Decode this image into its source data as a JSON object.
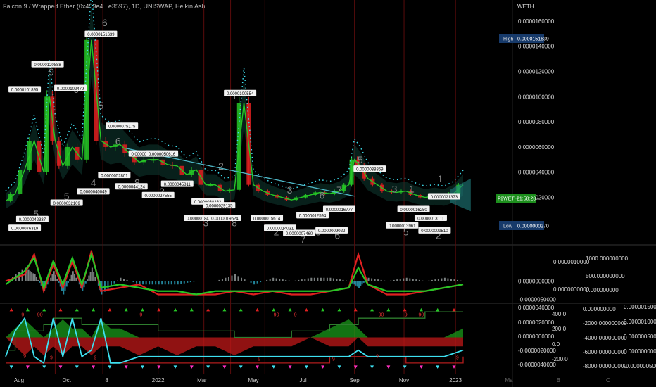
{
  "header": {
    "title": "Falcon 9 / Wrapped Ether (0x459e4...e3597), 1D, UNISWAP, Heikin Ashi"
  },
  "price_unit": "WETH",
  "colors": {
    "up": "#26c726",
    "down": "#e02020",
    "cyan": "#3ee0f0",
    "magenta": "#ff30c0",
    "olive": "#2e7d2e",
    "teal": "#1f7f7f"
  },
  "chart_data": [
    {
      "type": "line",
      "title": "",
      "y_axis_ticks": [
        "0.0000160000",
        "0.0000140000",
        "0.0000120000",
        "0.0000100000",
        "0.0000080000",
        "0.0000060000",
        "0.0000040000",
        "0.0000020000"
      ],
      "y_ticks_values": [
        16.0,
        14.0,
        12.0,
        10.0,
        8.0,
        6.0,
        4.0,
        2.0
      ],
      "ylim": [
        -1.6,
        17.0
      ],
      "value_scale": "1e-6 WETH",
      "x_axis_ticks": [
        "Aug",
        "Oct",
        "8",
        "2022",
        "Mar",
        "May",
        "Jul",
        "Sep",
        "Nov",
        "2023",
        "Ma",
        "B",
        "C",
        "D"
      ],
      "x_tick_index": [
        0.7,
        3.2,
        5.3,
        8.0,
        10.3,
        13.0,
        15.6,
        18.3,
        20.9,
        23.6,
        26.4,
        29.0,
        31.6,
        34.3
      ],
      "series": [
        {
          "role": "price",
          "x": [
            0,
            0.5,
            1,
            1.5,
            2,
            2.3,
            2.6,
            3,
            3.5,
            4,
            4.5,
            5,
            5.5,
            6,
            6.5,
            7,
            7.5,
            8,
            8.5,
            9,
            9.5,
            10,
            10.5,
            11,
            11.5,
            12,
            12.5,
            13,
            13.5,
            14,
            14.5,
            15,
            15.5,
            16,
            16.5,
            17,
            17.5,
            18,
            18.3,
            18.6,
            19,
            19.5,
            20,
            20.5,
            21,
            21.5,
            22,
            22.5,
            23,
            23.5,
            24
          ],
          "values": [
            1.7,
            2.3,
            4.2,
            6.5,
            4.0,
            10.0,
            6.5,
            4.5,
            6.0,
            5.0,
            14.5,
            6.5,
            6.0,
            6.2,
            5.5,
            4.8,
            5.0,
            5.0,
            4.6,
            4.5,
            3.8,
            4.2,
            3.0,
            3.0,
            2.5,
            2.6,
            9.5,
            3.0,
            2.5,
            2.2,
            2.0,
            1.8,
            2.0,
            2.2,
            2.4,
            2.3,
            2.5,
            3.0,
            5.0,
            4.5,
            3.5,
            3.0,
            2.5,
            2.4,
            2.5,
            2.2,
            2.0,
            2.1,
            2.0,
            2.3,
            3.0
          ]
        }
      ],
      "markers": {
        "high_label": "High",
        "high_value": "0.0000151639",
        "low_label": "Low",
        "low_value": "0.0000000270",
        "last_symbol": "F9WETH",
        "last_time": "21:58:28"
      },
      "counts": [
        {
          "x": 1.6,
          "y": 0.4,
          "text": "5"
        },
        {
          "x": 2.4,
          "y": 11.7,
          "text": "9"
        },
        {
          "x": 3.2,
          "y": 1.8,
          "text": "5"
        },
        {
          "x": 3.7,
          "y": 10.3,
          "text": "6"
        },
        {
          "x": 4.6,
          "y": 2.9,
          "text": "4"
        },
        {
          "x": 5.2,
          "y": 15.6,
          "text": "6"
        },
        {
          "x": 5.0,
          "y": 9.0,
          "text": "5"
        },
        {
          "x": 5.9,
          "y": 6.2,
          "text": "6"
        },
        {
          "x": 6.9,
          "y": 2.9,
          "text": "8"
        },
        {
          "x": 8.2,
          "y": 2.2,
          "text": "2"
        },
        {
          "x": 10.5,
          "y": -0.3,
          "text": "3"
        },
        {
          "x": 11.3,
          "y": 4.2,
          "text": "2"
        },
        {
          "x": 12.0,
          "y": -0.3,
          "text": "8"
        },
        {
          "x": 12.0,
          "y": 9.8,
          "text": "1"
        },
        {
          "x": 14.2,
          "y": -1.0,
          "text": "2"
        },
        {
          "x": 14.9,
          "y": 2.3,
          "text": "3"
        },
        {
          "x": 15.6,
          "y": -1.6,
          "text": "7"
        },
        {
          "x": 16.4,
          "y": -1.0,
          "text": "3"
        },
        {
          "x": 16.6,
          "y": 1.9,
          "text": "6"
        },
        {
          "x": 17.4,
          "y": -1.3,
          "text": "6"
        },
        {
          "x": 17.5,
          "y": 2.3,
          "text": "7"
        },
        {
          "x": 18.6,
          "y": 4.7,
          "text": "5"
        },
        {
          "x": 20.4,
          "y": 2.4,
          "text": "3"
        },
        {
          "x": 21.0,
          "y": -1.0,
          "text": "5"
        },
        {
          "x": 21.3,
          "y": 2.4,
          "text": "1"
        },
        {
          "x": 22.7,
          "y": -1.3,
          "text": "2"
        },
        {
          "x": 22.8,
          "y": 3.2,
          "text": "1"
        }
      ],
      "value_labels": [
        {
          "x": 1.0,
          "y": -0.5,
          "text": "0.0000076319"
        },
        {
          "x": 1.4,
          "y": 0.2,
          "text": "0.0000042337"
        },
        {
          "x": 1.0,
          "y": 10.5,
          "text": "0.0000101895"
        },
        {
          "x": 2.2,
          "y": 12.5,
          "text": "0.0000120888"
        },
        {
          "x": 3.2,
          "y": 1.5,
          "text": "0.0000032109"
        },
        {
          "x": 3.4,
          "y": 10.6,
          "text": "0.0000102479"
        },
        {
          "x": 4.6,
          "y": 2.4,
          "text": "0.0000040049"
        },
        {
          "x": 5.0,
          "y": 14.9,
          "text": "0.0000151639"
        },
        {
          "x": 5.7,
          "y": 3.7,
          "text": "0.0000052801"
        },
        {
          "x": 6.1,
          "y": 7.6,
          "text": "0.0000075175"
        },
        {
          "x": 6.6,
          "y": 2.8,
          "text": "0.0000044124"
        },
        {
          "x": 7.3,
          "y": 5.4,
          "text": "0.0000050036"
        },
        {
          "x": 8.0,
          "y": 2.1,
          "text": "0.0000027555"
        },
        {
          "x": 8.2,
          "y": 5.4,
          "text": "0.0000050616"
        },
        {
          "x": 9.0,
          "y": 3.0,
          "text": "0.0000045811"
        },
        {
          "x": 10.2,
          "y": 0.3,
          "text": "0.0000018452"
        },
        {
          "x": 10.6,
          "y": 1.6,
          "text": "0.0000038262"
        },
        {
          "x": 11.2,
          "y": 1.3,
          "text": "0.0000029135"
        },
        {
          "x": 11.5,
          "y": 0.3,
          "text": "0.0000019524"
        },
        {
          "x": 12.3,
          "y": 10.2,
          "text": "0.0000100554"
        },
        {
          "x": 13.7,
          "y": 0.3,
          "text": "0.0000015614"
        },
        {
          "x": 14.4,
          "y": -0.5,
          "text": "0.0000014031"
        },
        {
          "x": 15.4,
          "y": -0.9,
          "text": "0.0000007460"
        },
        {
          "x": 16.1,
          "y": 0.5,
          "text": "0.0000012594"
        },
        {
          "x": 17.1,
          "y": -0.7,
          "text": "0.0000009022"
        },
        {
          "x": 17.5,
          "y": 1.0,
          "text": "0.0000016777"
        },
        {
          "x": 19.1,
          "y": 4.2,
          "text": "0.0000038869"
        },
        {
          "x": 20.8,
          "y": -0.3,
          "text": "0.0000013961"
        },
        {
          "x": 21.4,
          "y": 1.0,
          "text": "0.0000016250"
        },
        {
          "x": 22.3,
          "y": 0.3,
          "text": "0.0000013111"
        },
        {
          "x": 22.5,
          "y": -0.7,
          "text": "0.0000009510"
        },
        {
          "x": 23.0,
          "y": 2.0,
          "text": "0.0000021373"
        }
      ]
    },
    {
      "type": "area",
      "title": "",
      "y_axis_ticks": [
        "0.0000000000",
        "-0.0000050000"
      ],
      "ticks_mid": [
        "0.0000010000",
        "0.0000000000"
      ],
      "ticks_right": [
        "1000.000000000",
        "500.000000000",
        "0.000000000"
      ],
      "ylim": [
        -6,
        10
      ],
      "x": [
        0,
        1,
        1.5,
        2,
        2.5,
        3,
        3.5,
        4,
        4.5,
        5,
        6,
        7,
        8,
        9,
        10,
        11,
        12,
        13,
        14,
        15,
        16,
        17,
        18,
        18.5,
        19,
        20,
        21,
        22,
        23,
        24
      ],
      "series": [
        {
          "role": "oscillator_red",
          "values": [
            0,
            2,
            8,
            -3,
            5,
            -2,
            6,
            -2,
            9,
            -3,
            -2,
            -1,
            -4,
            -4,
            -4,
            -4,
            -3,
            -4,
            -3,
            -4,
            -4,
            -3,
            -2,
            8,
            -1,
            -4,
            -4,
            -3,
            -2,
            -1
          ]
        },
        {
          "role": "oscillator_green",
          "values": [
            -1,
            3,
            7,
            -2,
            6,
            -1,
            7,
            -1,
            8,
            -2,
            -1,
            -2,
            -3,
            -3,
            -4,
            -3,
            -3,
            -3,
            -3,
            -3,
            -3,
            -3,
            -2,
            4,
            -1,
            -3,
            -3,
            -3,
            -2,
            -1
          ]
        },
        {
          "role": "histogram",
          "values": [
            0,
            4,
            2,
            -3,
            3,
            -4,
            3,
            -3,
            4,
            -4,
            1,
            -1,
            -1,
            -1,
            0,
            0,
            2,
            -1,
            1,
            0,
            1,
            1,
            0,
            -2,
            1,
            0,
            1,
            0,
            1,
            0
          ]
        }
      ]
    },
    {
      "type": "line",
      "title": "",
      "y_axis_ticks": [
        "0.0000040000",
        "0.0000020000",
        "0.0000000000",
        "-0.0000020000",
        "-0.0000040000"
      ],
      "ticks_mid": [
        "400.0",
        "200.0",
        "0.0",
        "-200.0"
      ],
      "ticks_right1": [
        "0.000000000",
        "-2000.000000000",
        "-4000.000000000",
        "-6000.000000000",
        "-8000.000000000"
      ],
      "ticks_right2": [
        "0.0000015000",
        "0.0000010000",
        "0.0000005000",
        "0.0000000000",
        "-0.0000005000"
      ],
      "ylim": [
        -5,
        5
      ],
      "x": [
        0,
        0.5,
        1,
        1.5,
        2,
        2.5,
        3,
        3.5,
        4,
        4.5,
        5,
        5.5,
        6,
        7,
        8,
        9,
        10,
        11,
        12,
        13,
        14,
        15,
        16,
        17,
        18,
        18.5,
        19,
        20,
        21,
        22,
        23,
        24
      ],
      "series": [
        {
          "role": "cyan_line",
          "values": [
            -3,
            1,
            3,
            -3,
            -4,
            3,
            -3,
            3,
            -3,
            -2,
            3,
            -4,
            -4,
            -3,
            -3,
            -3,
            -3,
            -3,
            -3,
            -3,
            -3,
            -3,
            -3,
            -3,
            -3,
            -2,
            -3,
            -3,
            -3,
            -3,
            -3,
            -2
          ]
        },
        {
          "role": "green_step",
          "values": [
            -2,
            1,
            1,
            1,
            2,
            3,
            3,
            3,
            2,
            2,
            2,
            2,
            2,
            2,
            1,
            1,
            1,
            1,
            0,
            0,
            0,
            1,
            1,
            2,
            2,
            3,
            3,
            3,
            3,
            4,
            4,
            4
          ]
        },
        {
          "role": "red_step",
          "values": [
            -4,
            -4,
            -4,
            -4,
            -4,
            -4,
            -4,
            -4,
            -4,
            -4,
            -4,
            -4,
            -4,
            -4,
            -4,
            -4,
            -4,
            -4,
            -4,
            -4,
            -4,
            -4,
            -4,
            -3,
            -3,
            -3,
            -3,
            -3,
            -4,
            -4,
            -4,
            -3
          ]
        },
        {
          "role": "red_area",
          "values": [
            0,
            -1,
            -2,
            -1,
            -2,
            -1,
            -2,
            -1,
            -1,
            -2,
            -1,
            -1,
            -1,
            -2,
            -1,
            -2,
            -1,
            -1,
            -2,
            -1,
            -1,
            -1,
            0,
            -1,
            -1,
            0,
            -1,
            -1,
            -1,
            -1,
            -1,
            -1
          ]
        },
        {
          "role": "green_area",
          "values": [
            0,
            1,
            2,
            1,
            0,
            1,
            2,
            1,
            1,
            0,
            2,
            1,
            1,
            0,
            0,
            0,
            0,
            0,
            0,
            0,
            0,
            0,
            0,
            1,
            2,
            1,
            0,
            0,
            0,
            0,
            0,
            1
          ]
        }
      ],
      "signal_labels": [
        {
          "x": 0.9,
          "y": 3.3,
          "text": "9"
        },
        {
          "x": 1.8,
          "y": 3.3,
          "text": "90"
        },
        {
          "x": 7.1,
          "y": 3.3,
          "text": "9"
        },
        {
          "x": 14.2,
          "y": 3.3,
          "text": "90"
        },
        {
          "x": 15.2,
          "y": 3.3,
          "text": "9"
        },
        {
          "x": 19.7,
          "y": 3.3,
          "text": "90"
        },
        {
          "x": 21.0,
          "y": 3.3,
          "text": "9"
        },
        {
          "x": 21.8,
          "y": 3.3,
          "text": "90"
        },
        {
          "x": 1.0,
          "y": -3.2,
          "text": "9"
        },
        {
          "x": 2.4,
          "y": -3.4,
          "text": "9"
        },
        {
          "x": 4.7,
          "y": -3.4,
          "text": "9"
        },
        {
          "x": 13.3,
          "y": -3.6,
          "text": "9"
        },
        {
          "x": 17.2,
          "y": -3.6,
          "text": "9"
        },
        {
          "x": 19.5,
          "y": -3.2,
          "text": "9"
        },
        {
          "x": 23.7,
          "y": -3.4,
          "text": "9"
        }
      ]
    }
  ]
}
